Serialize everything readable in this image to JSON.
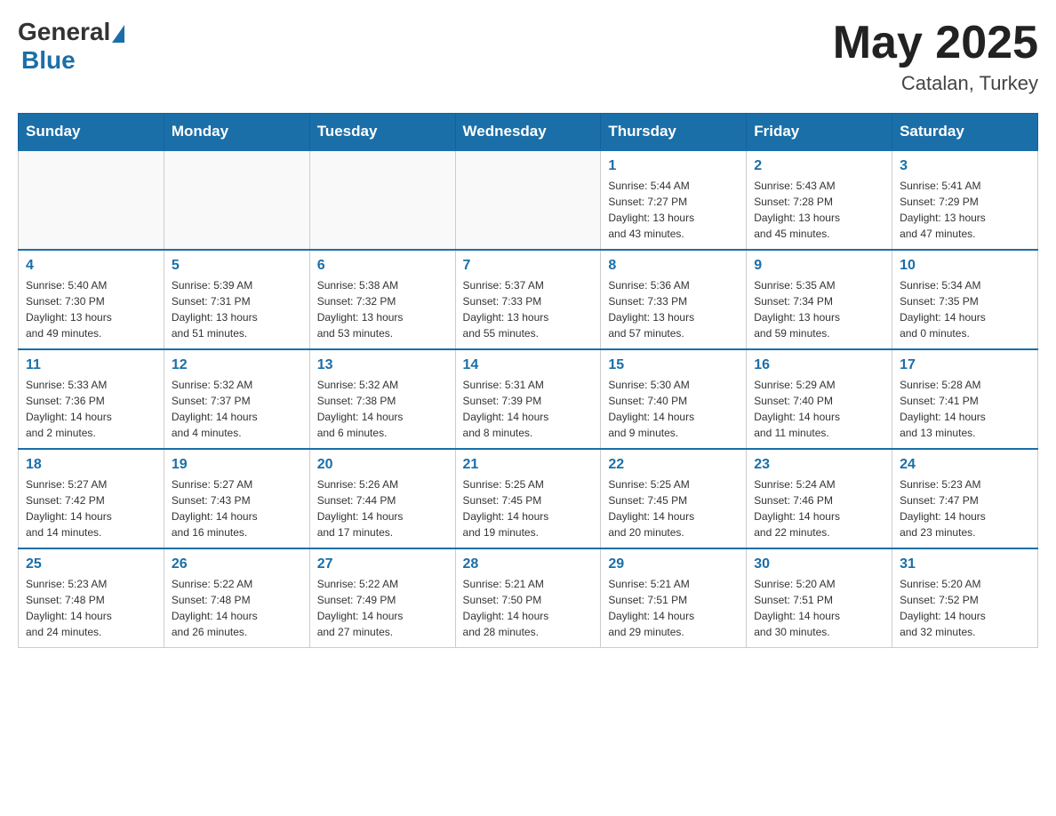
{
  "header": {
    "logo_general": "General",
    "logo_blue": "Blue",
    "month_year": "May 2025",
    "location": "Catalan, Turkey"
  },
  "days_of_week": [
    "Sunday",
    "Monday",
    "Tuesday",
    "Wednesday",
    "Thursday",
    "Friday",
    "Saturday"
  ],
  "weeks": [
    [
      {
        "day": "",
        "info": ""
      },
      {
        "day": "",
        "info": ""
      },
      {
        "day": "",
        "info": ""
      },
      {
        "day": "",
        "info": ""
      },
      {
        "day": "1",
        "info": "Sunrise: 5:44 AM\nSunset: 7:27 PM\nDaylight: 13 hours\nand 43 minutes."
      },
      {
        "day": "2",
        "info": "Sunrise: 5:43 AM\nSunset: 7:28 PM\nDaylight: 13 hours\nand 45 minutes."
      },
      {
        "day": "3",
        "info": "Sunrise: 5:41 AM\nSunset: 7:29 PM\nDaylight: 13 hours\nand 47 minutes."
      }
    ],
    [
      {
        "day": "4",
        "info": "Sunrise: 5:40 AM\nSunset: 7:30 PM\nDaylight: 13 hours\nand 49 minutes."
      },
      {
        "day": "5",
        "info": "Sunrise: 5:39 AM\nSunset: 7:31 PM\nDaylight: 13 hours\nand 51 minutes."
      },
      {
        "day": "6",
        "info": "Sunrise: 5:38 AM\nSunset: 7:32 PM\nDaylight: 13 hours\nand 53 minutes."
      },
      {
        "day": "7",
        "info": "Sunrise: 5:37 AM\nSunset: 7:33 PM\nDaylight: 13 hours\nand 55 minutes."
      },
      {
        "day": "8",
        "info": "Sunrise: 5:36 AM\nSunset: 7:33 PM\nDaylight: 13 hours\nand 57 minutes."
      },
      {
        "day": "9",
        "info": "Sunrise: 5:35 AM\nSunset: 7:34 PM\nDaylight: 13 hours\nand 59 minutes."
      },
      {
        "day": "10",
        "info": "Sunrise: 5:34 AM\nSunset: 7:35 PM\nDaylight: 14 hours\nand 0 minutes."
      }
    ],
    [
      {
        "day": "11",
        "info": "Sunrise: 5:33 AM\nSunset: 7:36 PM\nDaylight: 14 hours\nand 2 minutes."
      },
      {
        "day": "12",
        "info": "Sunrise: 5:32 AM\nSunset: 7:37 PM\nDaylight: 14 hours\nand 4 minutes."
      },
      {
        "day": "13",
        "info": "Sunrise: 5:32 AM\nSunset: 7:38 PM\nDaylight: 14 hours\nand 6 minutes."
      },
      {
        "day": "14",
        "info": "Sunrise: 5:31 AM\nSunset: 7:39 PM\nDaylight: 14 hours\nand 8 minutes."
      },
      {
        "day": "15",
        "info": "Sunrise: 5:30 AM\nSunset: 7:40 PM\nDaylight: 14 hours\nand 9 minutes."
      },
      {
        "day": "16",
        "info": "Sunrise: 5:29 AM\nSunset: 7:40 PM\nDaylight: 14 hours\nand 11 minutes."
      },
      {
        "day": "17",
        "info": "Sunrise: 5:28 AM\nSunset: 7:41 PM\nDaylight: 14 hours\nand 13 minutes."
      }
    ],
    [
      {
        "day": "18",
        "info": "Sunrise: 5:27 AM\nSunset: 7:42 PM\nDaylight: 14 hours\nand 14 minutes."
      },
      {
        "day": "19",
        "info": "Sunrise: 5:27 AM\nSunset: 7:43 PM\nDaylight: 14 hours\nand 16 minutes."
      },
      {
        "day": "20",
        "info": "Sunrise: 5:26 AM\nSunset: 7:44 PM\nDaylight: 14 hours\nand 17 minutes."
      },
      {
        "day": "21",
        "info": "Sunrise: 5:25 AM\nSunset: 7:45 PM\nDaylight: 14 hours\nand 19 minutes."
      },
      {
        "day": "22",
        "info": "Sunrise: 5:25 AM\nSunset: 7:45 PM\nDaylight: 14 hours\nand 20 minutes."
      },
      {
        "day": "23",
        "info": "Sunrise: 5:24 AM\nSunset: 7:46 PM\nDaylight: 14 hours\nand 22 minutes."
      },
      {
        "day": "24",
        "info": "Sunrise: 5:23 AM\nSunset: 7:47 PM\nDaylight: 14 hours\nand 23 minutes."
      }
    ],
    [
      {
        "day": "25",
        "info": "Sunrise: 5:23 AM\nSunset: 7:48 PM\nDaylight: 14 hours\nand 24 minutes."
      },
      {
        "day": "26",
        "info": "Sunrise: 5:22 AM\nSunset: 7:48 PM\nDaylight: 14 hours\nand 26 minutes."
      },
      {
        "day": "27",
        "info": "Sunrise: 5:22 AM\nSunset: 7:49 PM\nDaylight: 14 hours\nand 27 minutes."
      },
      {
        "day": "28",
        "info": "Sunrise: 5:21 AM\nSunset: 7:50 PM\nDaylight: 14 hours\nand 28 minutes."
      },
      {
        "day": "29",
        "info": "Sunrise: 5:21 AM\nSunset: 7:51 PM\nDaylight: 14 hours\nand 29 minutes."
      },
      {
        "day": "30",
        "info": "Sunrise: 5:20 AM\nSunset: 7:51 PM\nDaylight: 14 hours\nand 30 minutes."
      },
      {
        "day": "31",
        "info": "Sunrise: 5:20 AM\nSunset: 7:52 PM\nDaylight: 14 hours\nand 32 minutes."
      }
    ]
  ]
}
